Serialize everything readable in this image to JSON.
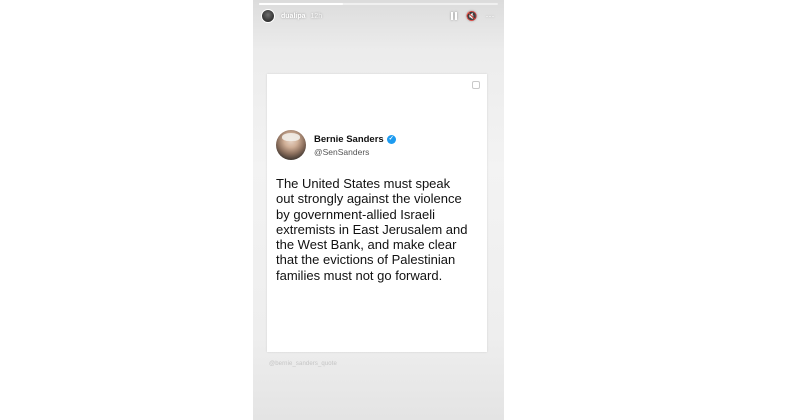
{
  "story": {
    "progress_fraction": 0.35,
    "account": {
      "username": "dualipa",
      "timestamp": "12h"
    },
    "controls": {
      "pause_icon": "pause-icon",
      "mute_icon": "speaker-off-icon",
      "mute_glyph": "🔇",
      "more_icon": "more-icon",
      "more_glyph": "⋯"
    },
    "caption": "@bernie_sanders_quote"
  },
  "tweet": {
    "display_name": "Bernie Sanders",
    "verified_glyph": "✓",
    "handle": "@SenSanders",
    "text": "The United States must speak\nout strongly against the violence\nby government-allied Israeli\nextremists in East Jerusalem and\nthe West Bank, and make clear\nthat the evictions of Palestinian\nfamilies must not go forward.",
    "verified_color": "#1d9bf0"
  }
}
